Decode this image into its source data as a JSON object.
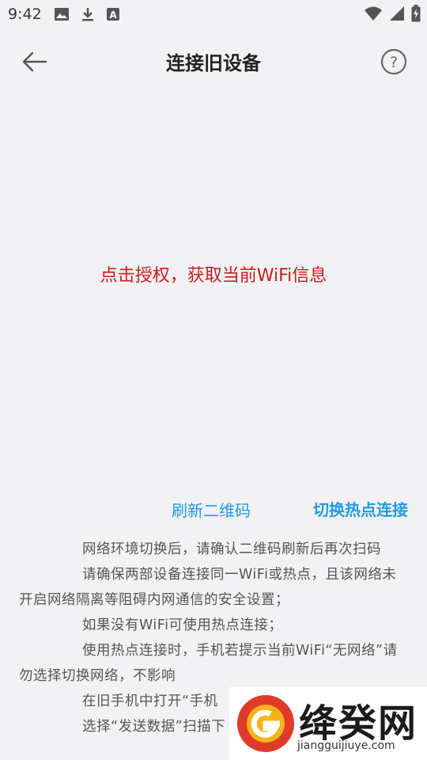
{
  "status_bar": {
    "time": "9:42",
    "left_icons": [
      "image-icon",
      "download-icon",
      "font-icon"
    ],
    "right_icons": [
      "wifi-icon",
      "signal-icon",
      "battery-icon"
    ]
  },
  "toolbar": {
    "title": "连接旧设备",
    "back_icon": "arrow-left-icon",
    "help_icon": "question-circle-icon"
  },
  "auth_prompt": "点击授权，获取当前WiFi信息",
  "links": {
    "refresh_qr": "刷新二维码",
    "switch_hotspot": "切换热点连接"
  },
  "instructions": [
    "网络环境切换后，请确认二维码刷新后再次扫码",
    "请确保两部设备连接同一WiFi或热点，且该网络未开启网络隔离等阻碍内网通信的安全设置；",
    "如果没有WiFi可使用热点连接；",
    "使用热点连接时，手机若提示当前WiFi“无网络”请勿选择切换网络，不影响",
    "在旧手机中打开“手机",
    "选择“发送数据”扫描下"
  ],
  "watermark": {
    "text": "绛癸网",
    "sub": "jiangguijiuye.com"
  },
  "colors": {
    "background": "#f2f2f4",
    "auth_text": "#c91b1b",
    "link": "#1e9be6"
  }
}
